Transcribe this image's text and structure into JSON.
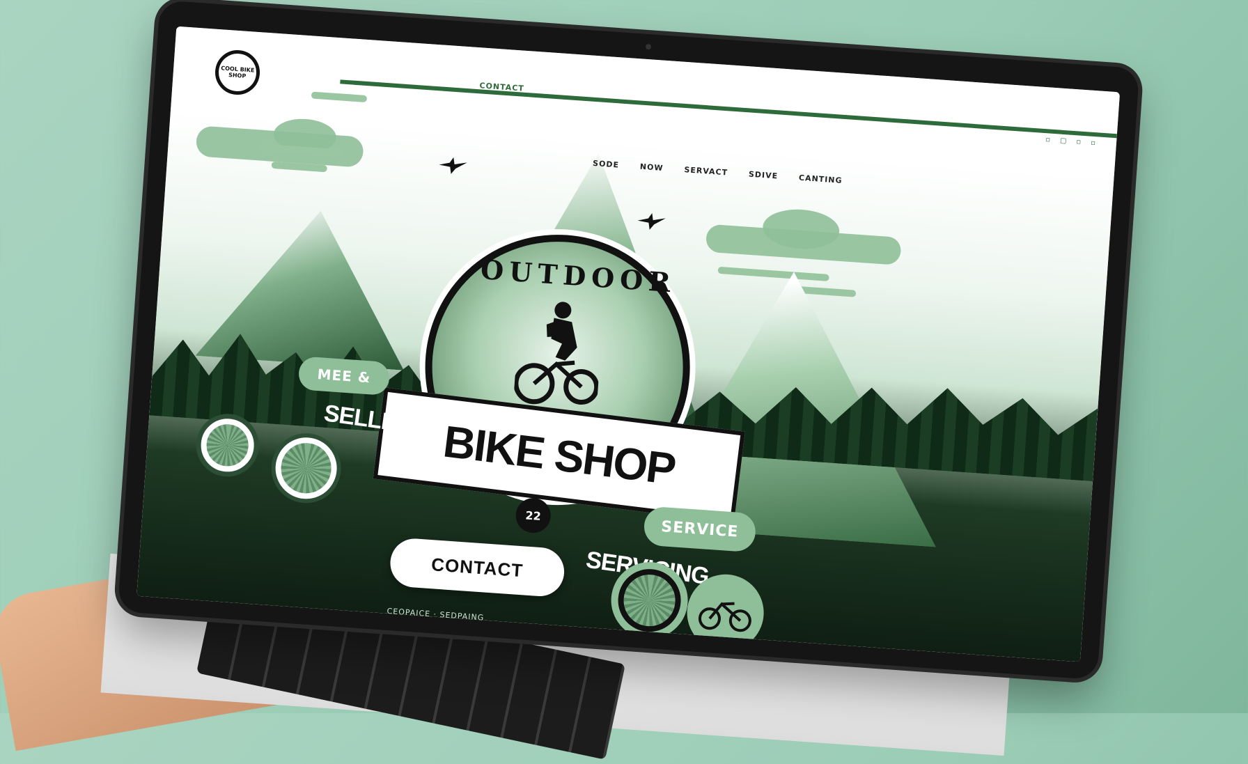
{
  "site": {
    "logo_text": "COOL BIKE SHOP",
    "contact_top": "CONTACT",
    "nav_items": [
      "SODE",
      "NOW",
      "SERVACT",
      "SDIVE",
      "CANTING"
    ],
    "window_icons": [
      "▫",
      "▢",
      "▫",
      "▫"
    ]
  },
  "hero": {
    "emblem_title": "OUTDOOR",
    "banner_title": "BIKE SHOP",
    "emblem_number": "22",
    "pill_left": "MEE &",
    "label_selling": "SELLING",
    "pill_right": "SERVICE",
    "label_servicing": "SERVICING",
    "contact_button": "CONTACT",
    "footer_text": "CEOPAICE · SEDPAING"
  },
  "colors": {
    "accent_dark": "#2e6b3a",
    "accent_light": "#8fbf98",
    "background": "#9ccdb7"
  }
}
